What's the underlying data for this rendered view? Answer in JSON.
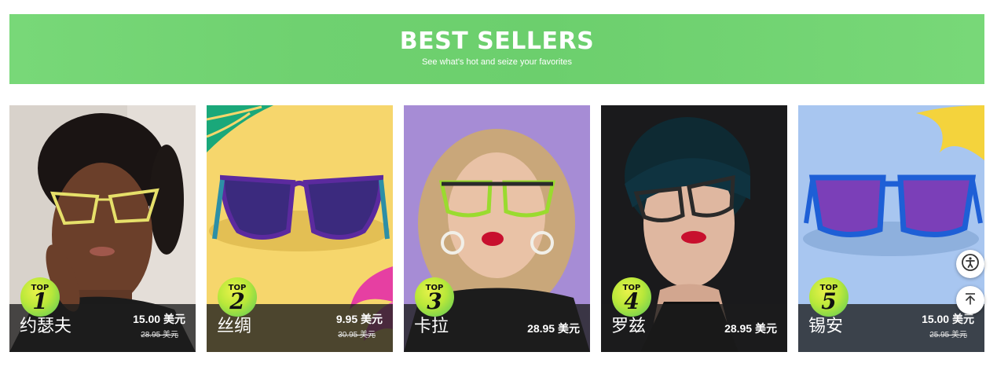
{
  "banner": {
    "title": "BEST SELLERS",
    "subtitle": "See what's hot and seize your favorites",
    "color": "#75d775"
  },
  "products": [
    {
      "rank_label": "TOP",
      "rank": "1",
      "name": "约瑟夫",
      "price": "15.00 美元",
      "original_price": "28.95 美元",
      "bg_color": "#d9d3cd",
      "frame_color": "#e6e06a"
    },
    {
      "rank_label": "TOP",
      "rank": "2",
      "name": "丝绸",
      "price": "9.95 美元",
      "original_price": "30.95 美元",
      "bg_color": "#f5d36a",
      "frame_color": "#5b2a9e"
    },
    {
      "rank_label": "TOP",
      "rank": "3",
      "name": "卡拉",
      "price": "28.95 美元",
      "original_price": "",
      "bg_color": "#a98fd6",
      "frame_color": "#9adb2f"
    },
    {
      "rank_label": "TOP",
      "rank": "4",
      "name": "罗兹",
      "price": "28.95 美元",
      "original_price": "",
      "bg_color": "#1c1c1e",
      "frame_color": "#2a2a2a"
    },
    {
      "rank_label": "TOP",
      "rank": "5",
      "name": "锡安",
      "price": "15.00 美元",
      "original_price": "25.95 美元",
      "bg_color": "#a6c4ef",
      "frame_color": "#1e5fd6"
    }
  ],
  "floating_buttons": {
    "accessibility_icon": "accessibility-icon",
    "back_to_top_icon": "arrow-up-to-top-icon"
  }
}
